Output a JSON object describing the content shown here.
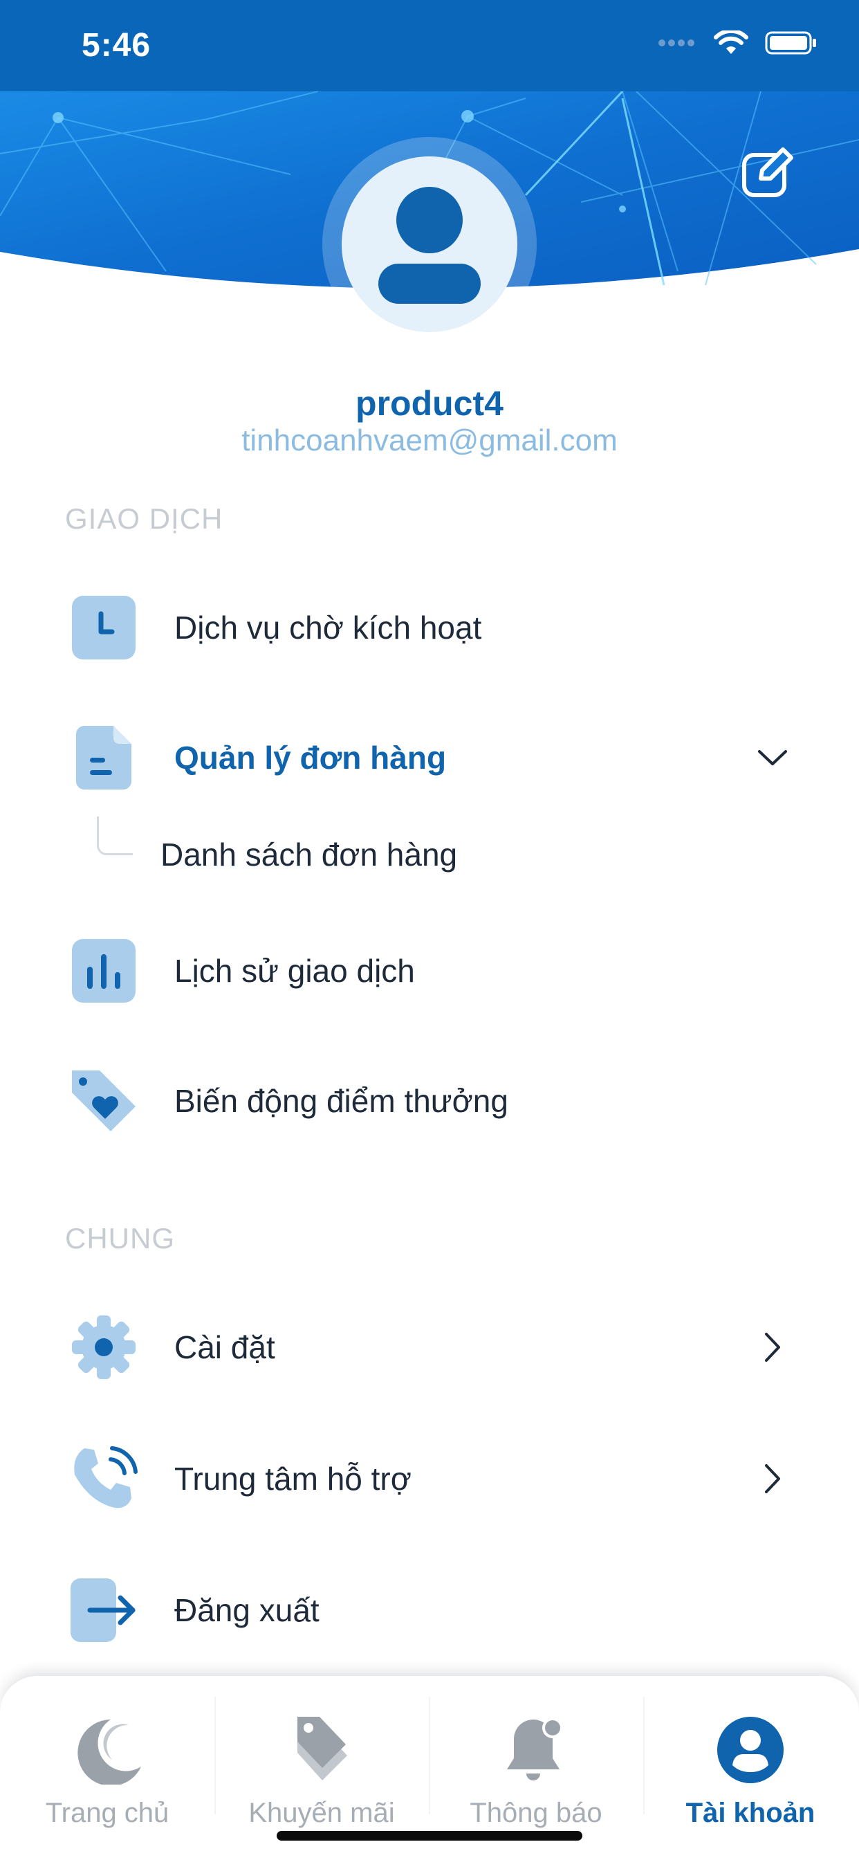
{
  "status_bar": {
    "time": "5:46",
    "icons": [
      "signal-dots-icon",
      "wifi-icon",
      "battery-icon"
    ]
  },
  "header": {
    "edit_icon": "edit-icon",
    "avatar_icon": "user-icon"
  },
  "profile": {
    "name": "product4",
    "email": "tinhcoanhvaem@gmail.com"
  },
  "sections": {
    "transactions": {
      "title": "GIAO DỊCH",
      "items": [
        {
          "label": "Dịch vụ chờ kích hoạt",
          "icon": "clock-icon"
        },
        {
          "label": "Quản lý đơn hàng",
          "icon": "document-icon",
          "expanded": true,
          "sub_items": [
            {
              "label": "Danh sách đơn hàng"
            }
          ]
        },
        {
          "label": "Lịch sử giao dịch",
          "icon": "bar-chart-icon"
        },
        {
          "label": "Biến động điểm thưởng",
          "icon": "heart-tag-icon"
        }
      ]
    },
    "general": {
      "title": "CHUNG",
      "items": [
        {
          "label": "Cài đặt",
          "icon": "gear-icon"
        },
        {
          "label": "Trung tâm hỗ trợ",
          "icon": "phone-icon"
        },
        {
          "label": "Đăng xuất",
          "icon": "logout-icon"
        }
      ]
    }
  },
  "tab_bar": {
    "tabs": [
      {
        "label": "Trang chủ",
        "icon": "home-moon-icon",
        "active": false
      },
      {
        "label": "Khuyến mãi",
        "icon": "tags-icon",
        "active": false
      },
      {
        "label": "Thông báo",
        "icon": "bell-icon",
        "active": false
      },
      {
        "label": "Tài khoản",
        "icon": "account-icon",
        "active": true
      }
    ]
  },
  "colors": {
    "primary": "#0f64ad",
    "status_bar": "#0a66b8",
    "icon_tile": "#a9cdea",
    "icon_fill": "#0f64ad",
    "section_title": "#c7ccd2",
    "tab_inactive": "#a7adb4",
    "email": "#8bbbe0"
  }
}
